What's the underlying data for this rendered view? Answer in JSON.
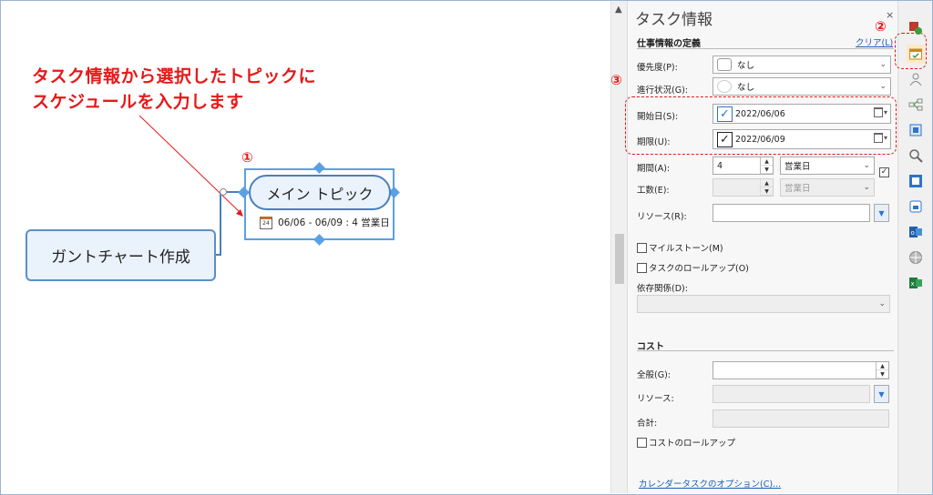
{
  "annotation": {
    "line1": "タスク情報から選択したトピックに",
    "line2": "スケジュールを入力します",
    "marker1": "①",
    "marker2": "②",
    "marker3": "③"
  },
  "map": {
    "central_topic": "ガントチャート作成",
    "main_topic": "メイン トピック",
    "schedule_label": "06/06 - 06/09 : 4 営業日",
    "calendar_icon_day": "24"
  },
  "panel": {
    "title": "タスク情報",
    "close": "×",
    "work_section": "仕事情報の定義",
    "clear_link": "クリア(L)",
    "priority_label": "優先度(P):",
    "priority_value": "なし",
    "progress_label": "進行状況(G):",
    "progress_value": "なし",
    "start_label": "開始日(S):",
    "start_value": "2022/06/06",
    "due_label": "期限(U):",
    "due_value": "2022/06/09",
    "duration_label": "期間(A):",
    "duration_value": "4",
    "duration_unit": "営業日",
    "effort_label": "工数(E):",
    "effort_unit": "営業日",
    "resource_label": "リソース(R):",
    "milestone_label": "マイルストーン(M)",
    "task_rollup_label": "タスクのロールアップ(O)",
    "dependency_label": "依存関係(D):",
    "cost_section": "コスト",
    "general_label": "全般(G):",
    "cost_resource_label": "リソース:",
    "total_label": "合計:",
    "cost_rollup_label": "コストのロールアップ",
    "calendar_options_link": "カレンダータスクのオプション(C)..."
  },
  "toolbar": {
    "icons": [
      "review-icon",
      "task-info-icon",
      "resource-icon",
      "map-parts-icon",
      "format-icon",
      "search-icon",
      "outlook-icon",
      "sharepoint-icon",
      "outlook-sync-icon",
      "web-icon",
      "excel-icon"
    ]
  },
  "colors": {
    "accent_red": "#e81818",
    "topic_border": "#4a7fbf",
    "selection_blue": "#5aa0e6",
    "link_blue": "#1a5fb4"
  }
}
